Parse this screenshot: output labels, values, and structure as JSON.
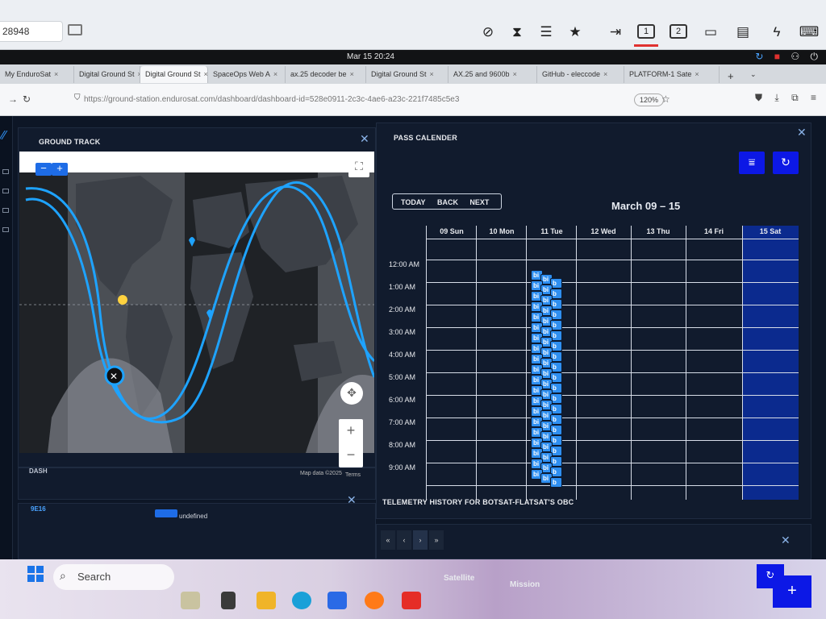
{
  "remote_toolbar": {
    "session_id": "28948",
    "icons": [
      "screen-off-icon",
      "hourglass-icon",
      "database-icon",
      "star-icon",
      "send-icon",
      "monitor-1-icon",
      "monitor-2-icon",
      "monitor-icon",
      "chat-icon",
      "lightning-icon",
      "keyboard-icon"
    ],
    "monitor_1": "1",
    "monitor_2": "2"
  },
  "os_bar": {
    "clock": "Mar 15  20:24"
  },
  "browser": {
    "tabs": [
      {
        "label": "My EnduroSat"
      },
      {
        "label": "Digital Ground St"
      },
      {
        "label": "Digital Ground St"
      },
      {
        "label": "SpaceOps Web A"
      },
      {
        "label": "ax.25 decoder be"
      },
      {
        "label": "Digital Ground St"
      },
      {
        "label": "AX.25 and 9600b"
      },
      {
        "label": "GitHub - eleccode"
      },
      {
        "label": "PLATFORM-1 Sate"
      }
    ],
    "url": "https://ground-station.endurosat.com/dashboard/dashboard-id=528e0911-2c3c-4ae6-a23c-221f7485c5e3",
    "zoom": "120%"
  },
  "ground_track": {
    "title": "GROUND TRACK",
    "zoom_out": "−",
    "zoom_in": "+",
    "map_data": "Map data ©2025",
    "terms": "Terms"
  },
  "dash": {
    "title": "DASH",
    "field_label": "9E16",
    "field_value": "undefined"
  },
  "calendar": {
    "title": "PASS CALENDER",
    "today": "TODAY",
    "back": "BACK",
    "next": "NEXT",
    "range": "March 09 – 15",
    "days": [
      "09 Sun",
      "10 Mon",
      "11 Tue",
      "12 Wed",
      "13 Thu",
      "14 Fri",
      "15 Sat"
    ],
    "hours": [
      "12:00 AM",
      "1:00 AM",
      "2:00 AM",
      "3:00 AM",
      "4:00 AM",
      "5:00 AM",
      "6:00 AM",
      "7:00 AM",
      "8:00 AM",
      "9:00 AM"
    ],
    "event_label": "bi",
    "event_label_short": "b"
  },
  "telemetry": {
    "title": "TELEMETRY HISTORY FOR BOTSAT-FLATSAT'S OBC",
    "pager": [
      "«",
      "‹",
      "›",
      "»"
    ],
    "columns": [
      "Satellite",
      "Mission"
    ]
  },
  "taskbar": {
    "search_placeholder": "Search"
  },
  "colors": {
    "accent": "#0c18e6",
    "track": "#1ea3ff",
    "event": "#2f8ff0",
    "background": "#0d1626"
  }
}
